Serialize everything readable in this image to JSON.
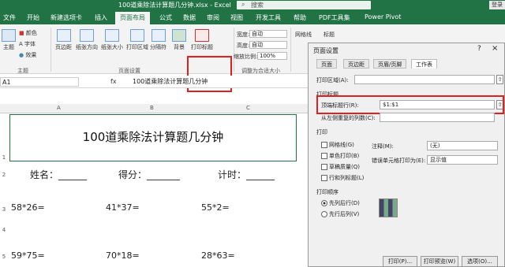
{
  "window": {
    "title": "100道乘除法计算题几分钟.xlsx - Excel",
    "search_placeholder": "搜索",
    "login": "登录"
  },
  "tabs": [
    {
      "label": "文件"
    },
    {
      "label": "开始"
    },
    {
      "label": "新建选项卡"
    },
    {
      "label": "插入"
    },
    {
      "label": "页面布局"
    },
    {
      "label": "公式"
    },
    {
      "label": "数据"
    },
    {
      "label": "审阅"
    },
    {
      "label": "视图"
    },
    {
      "label": "开发工具"
    },
    {
      "label": "帮助"
    },
    {
      "label": "PDF工具集"
    },
    {
      "label": "Power Pivot"
    }
  ],
  "ribbon": {
    "theme": {
      "label": "主题",
      "colors": "颜色",
      "fonts": "字体",
      "effects": "效果",
      "group": "主题"
    },
    "page_setup": {
      "margins": "页边距",
      "orientation": "纸张方向",
      "size": "纸张大小",
      "print_area": "打印区域",
      "breaks": "分隔符",
      "background": "背景",
      "print_titles": "打印标题",
      "group": "页面设置"
    },
    "scale": {
      "width_label": "宽度:",
      "width_value": "自动",
      "height_label": "高度:",
      "height_value": "自动",
      "scale_label": "缩放比例:",
      "scale_value": "100%",
      "group": "调整为合适大小"
    },
    "sheet_options": {
      "gridlines": "网格线",
      "headings": "标题"
    }
  },
  "formula_bar": {
    "name_box": "A1",
    "fx": "fx",
    "content": "100道乘除法计算题几分钟"
  },
  "columns": [
    "A",
    "B",
    "C"
  ],
  "sheet": {
    "title": "100道乘除法计算题几分钟",
    "name_label": "姓名：______",
    "score_label": "得分：_______",
    "time_label": "计时：______",
    "rows": [
      [
        "58*26=",
        "41*37=",
        "55*2="
      ],
      [
        "59*75=",
        "70*18=",
        "28*63="
      ]
    ],
    "row_numbers": [
      "1",
      "2",
      "3",
      "4",
      "5"
    ]
  },
  "dialog": {
    "title": "页面设置",
    "help": "?",
    "close": "×",
    "tabs": [
      "页面",
      "页边距",
      "页眉/页脚",
      "工作表"
    ],
    "print_area_label": "打印区域(A):",
    "print_titles_section": "打印标题",
    "rows_to_repeat_label": "顶端标题行(R):",
    "rows_to_repeat_value": "$1:$1",
    "cols_to_repeat_label": "从左侧重复的列数(C):",
    "print_section": "打印",
    "gridlines": "网格线(G)",
    "bw": "单色打印(B)",
    "draft": "草稿质量(Q)",
    "rowcol_headings": "行和列标题(L)",
    "comments_label": "注释(M):",
    "comments_value": "(无)",
    "errors_label": "错误单元格打印为(E):",
    "errors_value": "显示值",
    "order_section": "打印顺序",
    "down_then_over": "先列后行(D)",
    "over_then_down": "先行后列(V)",
    "print_btn": "打印(P)...",
    "preview_btn": "打印预览(W)",
    "options_btn": "选项(O)..."
  }
}
